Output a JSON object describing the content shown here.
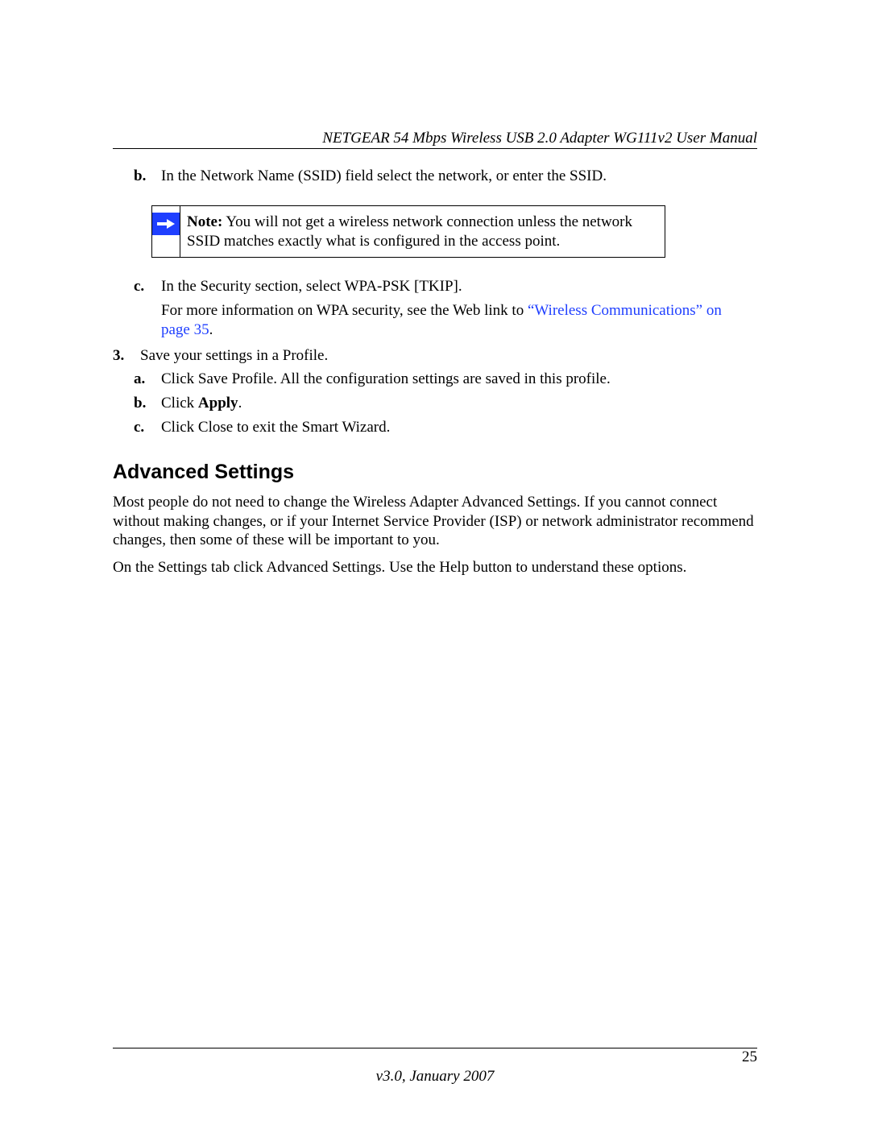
{
  "header": {
    "running_title": "NETGEAR 54 Mbps Wireless USB 2.0 Adapter WG111v2 User Manual"
  },
  "content": {
    "item_b": {
      "marker": "b.",
      "text": "In the Network Name (SSID) field select the network, or enter the SSID."
    },
    "note": {
      "label": "Note:",
      "text": " You will not get a wireless network connection unless the network SSID matches exactly what is configured in the access point."
    },
    "item_c": {
      "marker": "c.",
      "line1": "In the Security section, select WPA-PSK [TKIP].",
      "line2_pre": "For more information on WPA security, see the Web link to ",
      "line2_link": "“Wireless Communications” on page 35",
      "line2_post": "."
    },
    "step3": {
      "marker": "3.",
      "text": "Save your settings in a Profile.",
      "a": {
        "marker": "a.",
        "text": "Click Save Profile. All the configuration settings are saved in this profile."
      },
      "b": {
        "marker": "b.",
        "pre": "Click ",
        "bold": "Apply",
        "post": "."
      },
      "c": {
        "marker": "c.",
        "text": "Click Close to exit the Smart Wizard."
      }
    },
    "advanced": {
      "heading": "Advanced Settings",
      "p1": "Most people do not need to change the Wireless Adapter Advanced Settings. If you cannot connect without making changes, or if your Internet Service Provider (ISP) or network administrator recommend changes, then some of these will be important to you.",
      "p2": "On the Settings tab click Advanced Settings. Use the Help button to understand these options."
    }
  },
  "footer": {
    "page_number": "25",
    "version": "v3.0, January 2007"
  }
}
